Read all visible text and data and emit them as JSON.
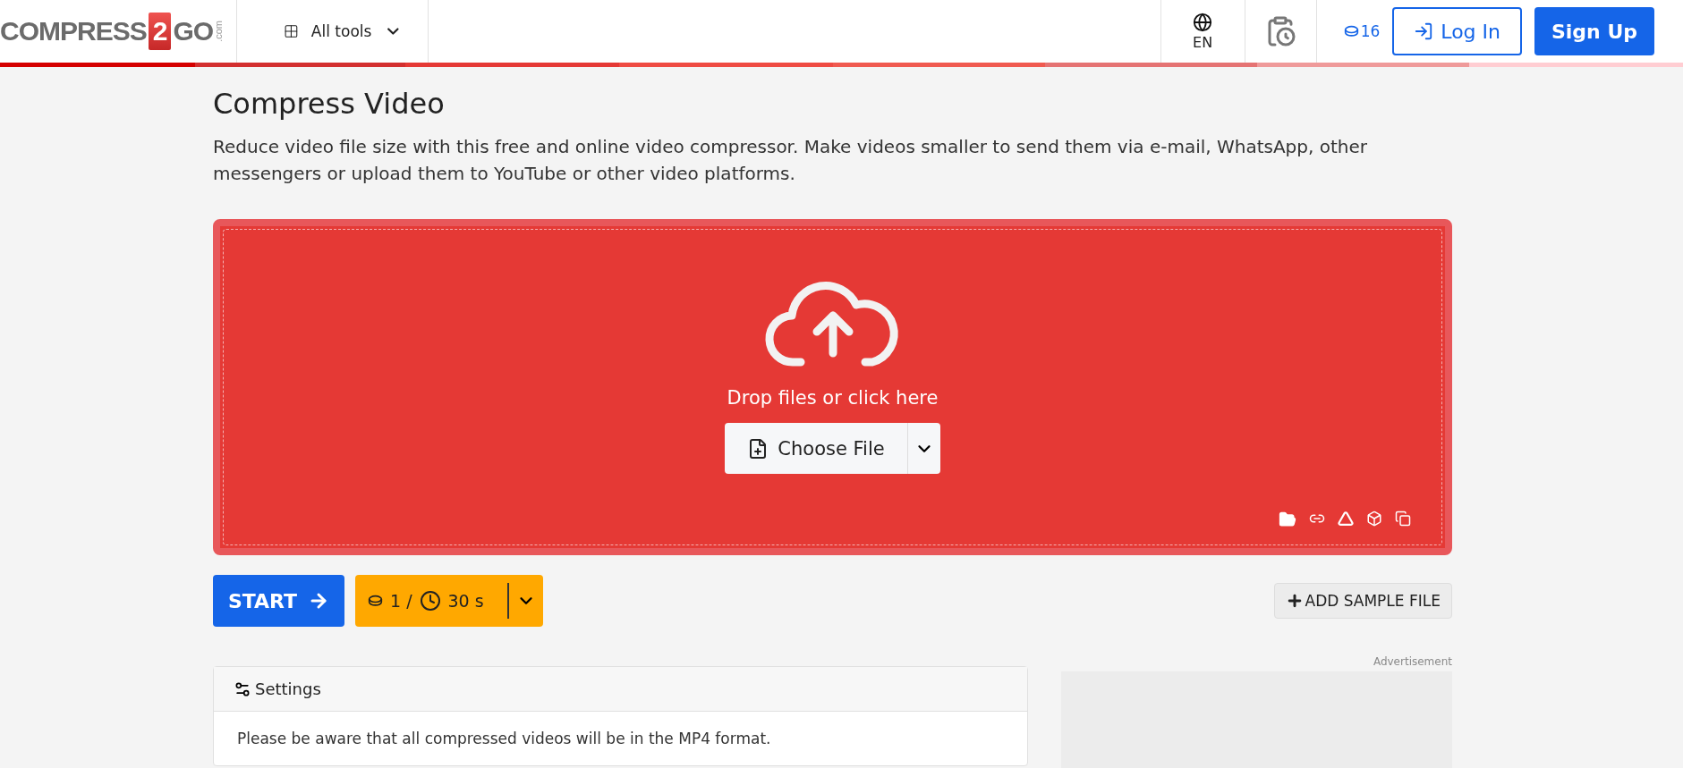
{
  "header": {
    "logo": {
      "left": "COMPRESS",
      "badge": "2",
      "right": "GO",
      "suffix": ".com"
    },
    "tools_menu": {
      "label": "All tools"
    },
    "language": {
      "label": "EN"
    },
    "credits": "16",
    "login": "Log In",
    "signup": "Sign Up"
  },
  "page": {
    "title": "Compress Video",
    "description": "Reduce video file size with this free and online video compressor. Make videos smaller to send them via e-mail, WhatsApp, other messengers or upload them to YouTube or other video platforms."
  },
  "dropzone": {
    "prompt": "Drop files or click here",
    "choose_file": "Choose File"
  },
  "actions": {
    "start": "START",
    "cost": "1 /",
    "time": "30 s",
    "add_sample": "ADD SAMPLE FILE"
  },
  "advertisement": {
    "label": "Advertisement"
  },
  "settings": {
    "title": "Settings",
    "note": "Please be aware that all compressed videos will be in the MP4 format."
  }
}
